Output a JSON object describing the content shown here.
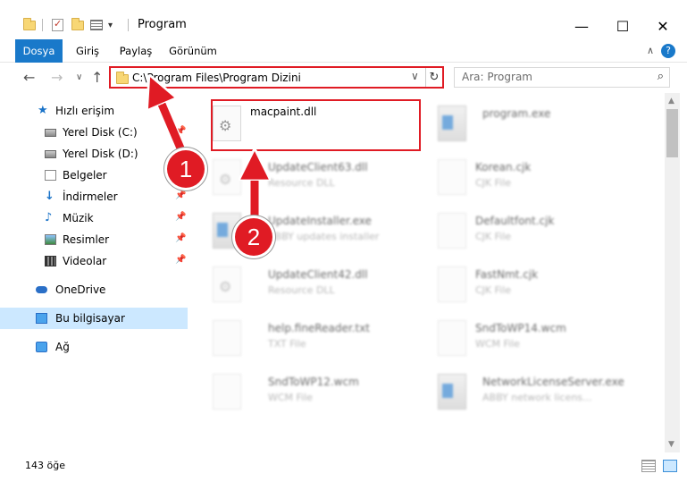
{
  "window": {
    "title": "Program",
    "minimize_glyph": "—",
    "maximize_glyph": "☐",
    "close_glyph": "✕"
  },
  "ribbon": {
    "tabs": [
      {
        "label": "Dosya",
        "active": true
      },
      {
        "label": "Giriş"
      },
      {
        "label": "Paylaş"
      },
      {
        "label": "Görünüm"
      }
    ],
    "help_glyph": "?"
  },
  "nav": {
    "back": "←",
    "forward": "→",
    "recent": "∨",
    "up": "↑",
    "address": "C:\\Program Files\\Program Dizini",
    "dropdown": "∨",
    "refresh": "↻",
    "search_placeholder": "Ara: Program",
    "search_icon": "⌕"
  },
  "sidebar": {
    "items": [
      {
        "label": "Hızlı erişim",
        "icon": "star-icon"
      },
      {
        "label": "Yerel Disk (C:)",
        "icon": "drive-icon",
        "pinned": true
      },
      {
        "label": "Yerel Disk (D:)",
        "icon": "drive-icon"
      },
      {
        "label": "Belgeler",
        "icon": "documents-icon"
      },
      {
        "label": "İndirmeler",
        "icon": "download-icon",
        "pinned": true
      },
      {
        "label": "Müzik",
        "icon": "music-icon",
        "pinned": true
      },
      {
        "label": "Resimler",
        "icon": "pictures-icon",
        "pinned": true
      },
      {
        "label": "Videolar",
        "icon": "videos-icon",
        "pinned": true
      },
      {
        "label": "OneDrive",
        "icon": "onedrive-icon"
      },
      {
        "label": "Bu bilgisayar",
        "icon": "computer-icon",
        "selected": true
      },
      {
        "label": "Ağ",
        "icon": "network-icon"
      }
    ],
    "pin_glyph": "📌"
  },
  "files": [
    {
      "name": "macpaint.dll",
      "type": "",
      "icon": "dll"
    },
    {
      "name": "program.exe",
      "type": "",
      "icon": "exe"
    },
    {
      "name": "UpdateClient63.dll",
      "type": "Resource DLL",
      "icon": "dll"
    },
    {
      "name": "Korean.cjk",
      "type": "CJK File",
      "icon": "file"
    },
    {
      "name": "UpdateInstaller.exe",
      "type": "ABBY updates installer",
      "icon": "exe"
    },
    {
      "name": "Defaultfont.cjk",
      "type": "CJK File",
      "icon": "file"
    },
    {
      "name": "UpdateClient42.dll",
      "type": "Resource DLL",
      "icon": "dll"
    },
    {
      "name": "FastNmt.cjk",
      "type": "CJK File",
      "icon": "file"
    },
    {
      "name": "help.fineReader.txt",
      "type": "TXT File",
      "icon": "file"
    },
    {
      "name": "SndToWP14.wcm",
      "type": "WCM File",
      "icon": "file"
    },
    {
      "name": "SndToWP12.wcm",
      "type": "WCM File",
      "icon": "file"
    },
    {
      "name": "NetworkLicenseServer.exe",
      "type": "ABBY network licens...",
      "icon": "exe"
    }
  ],
  "status": {
    "count": "143 öğe"
  },
  "annotations": {
    "callout_1": "1",
    "callout_2": "2",
    "color": "#e01b24"
  }
}
